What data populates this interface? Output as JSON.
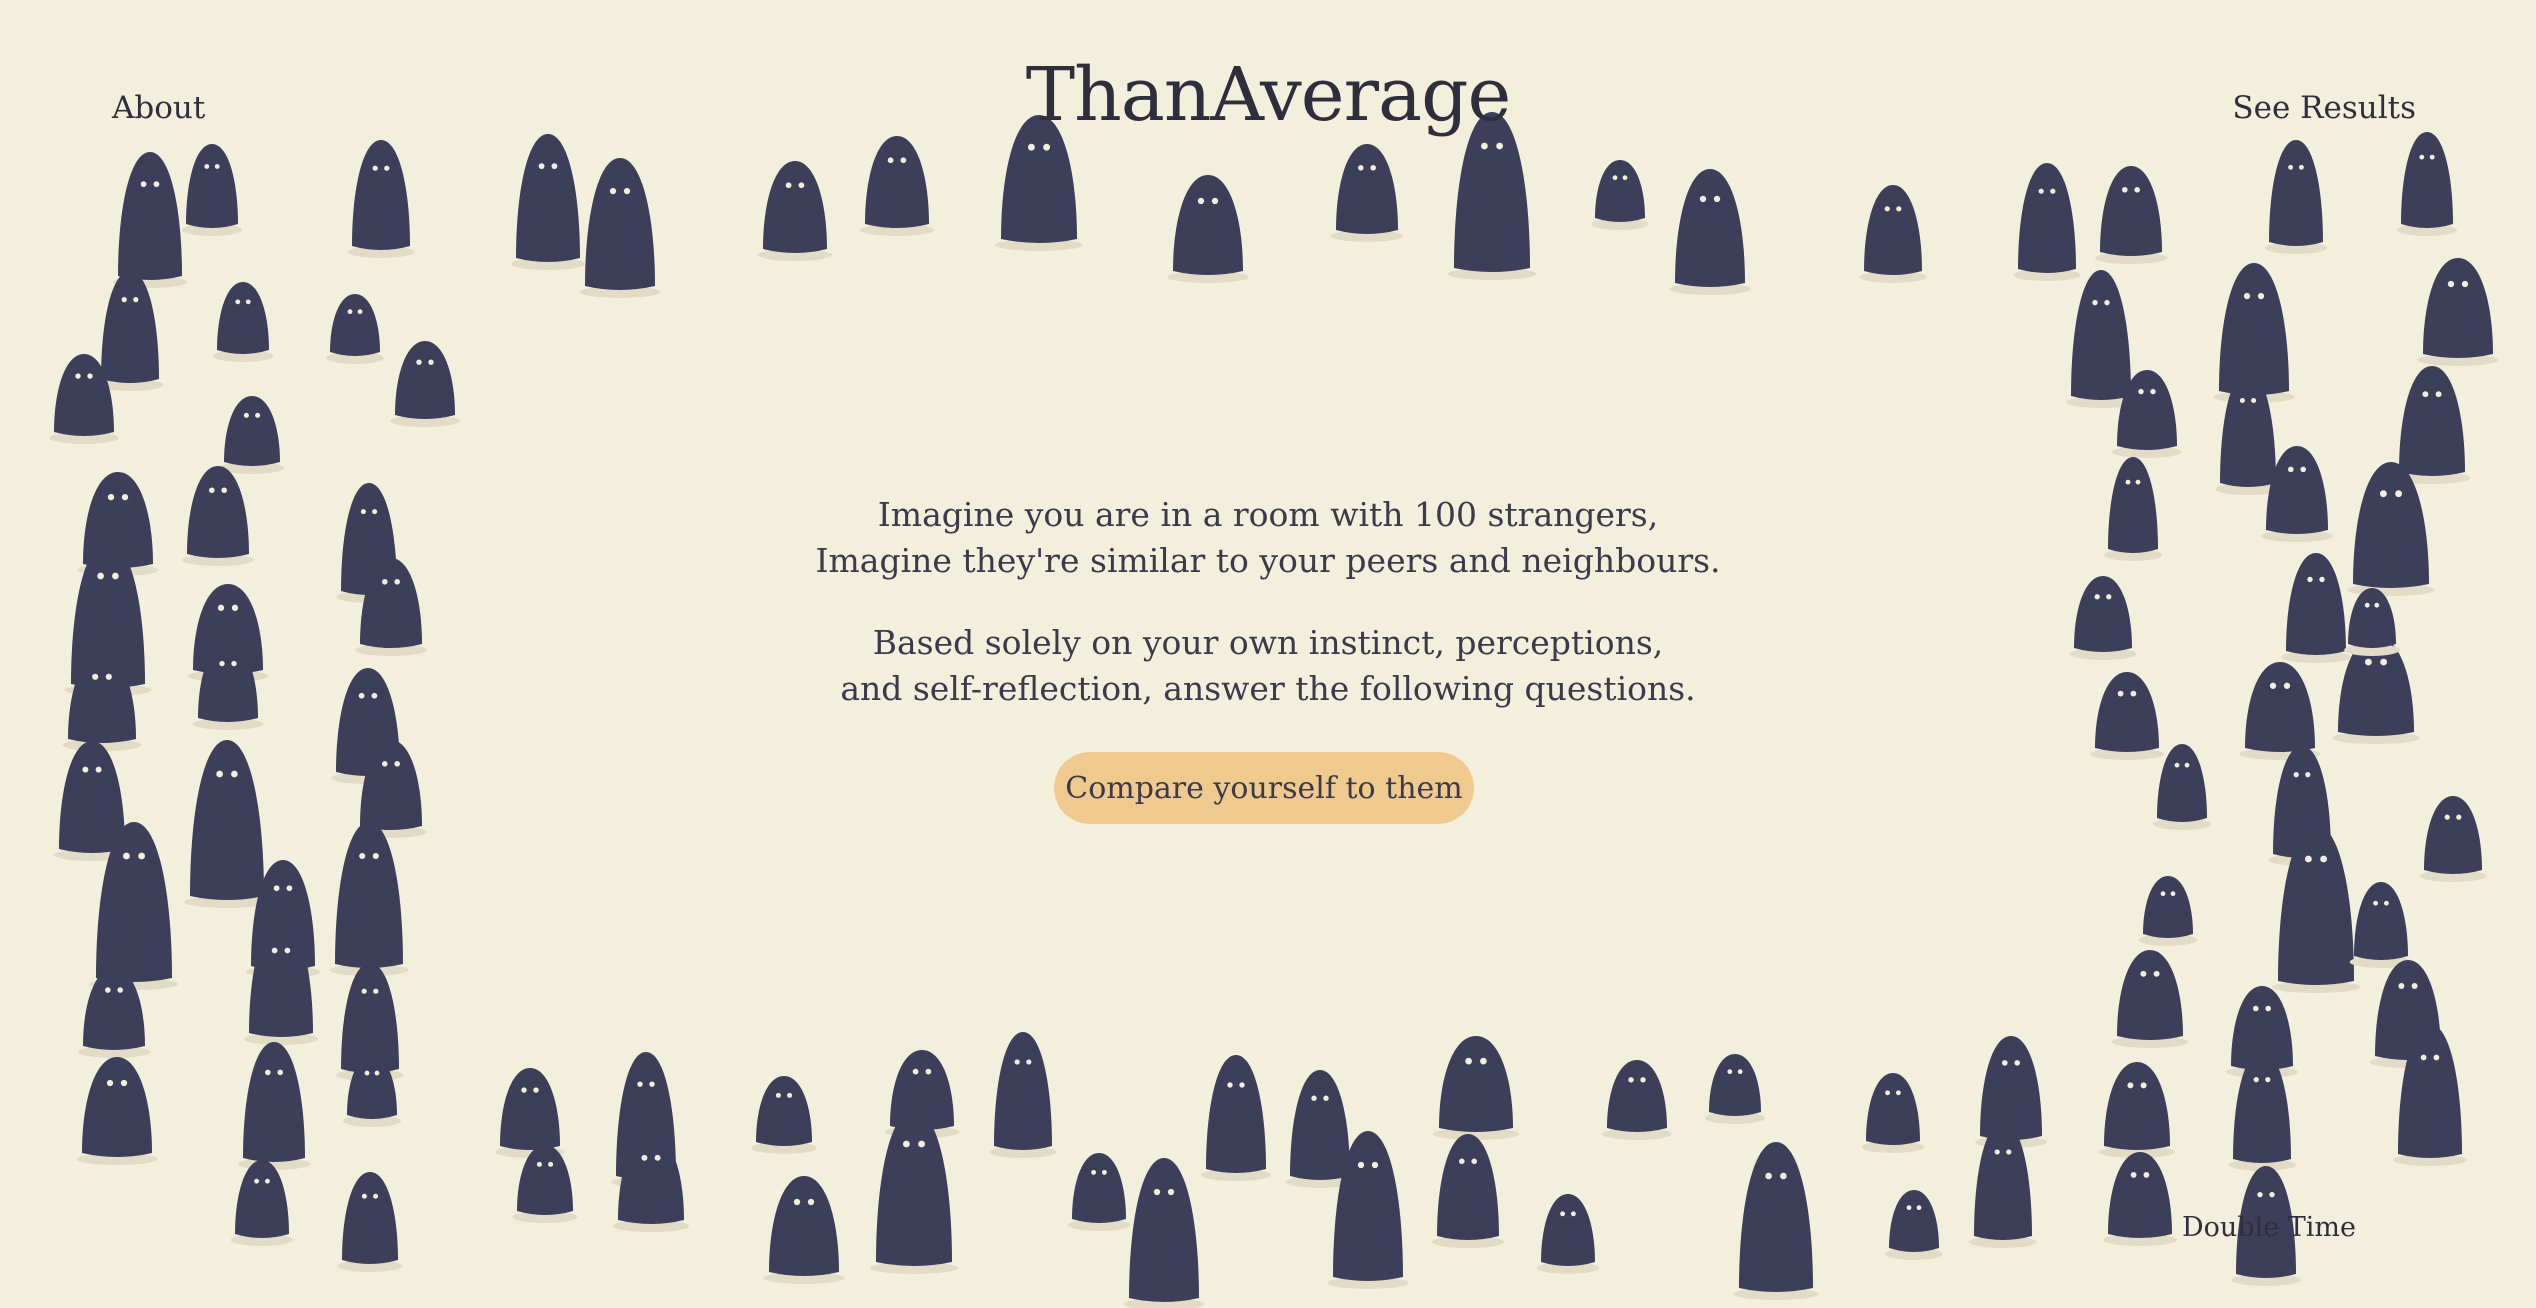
{
  "nav": {
    "about": "About",
    "see_results": "See Results"
  },
  "title": "ThanAverage",
  "intro": {
    "line1": "Imagine you are in a room with 100 strangers,",
    "line2": "Imagine they're similar to your peers and neighbours.",
    "line3": "Based solely on your own instinct, perceptions,",
    "line4": "and self-reflection, answer the following questions."
  },
  "cta_label": "Compare yourself to them",
  "footer_credit": "Double Time",
  "colors": {
    "background": "#f3efdd",
    "figure": "#3d3f5a",
    "button": "#f0c98f",
    "text": "#3b3a4a"
  },
  "decoration": {
    "figure_icon": "ghost-figure-icon",
    "figure_count": 100
  }
}
